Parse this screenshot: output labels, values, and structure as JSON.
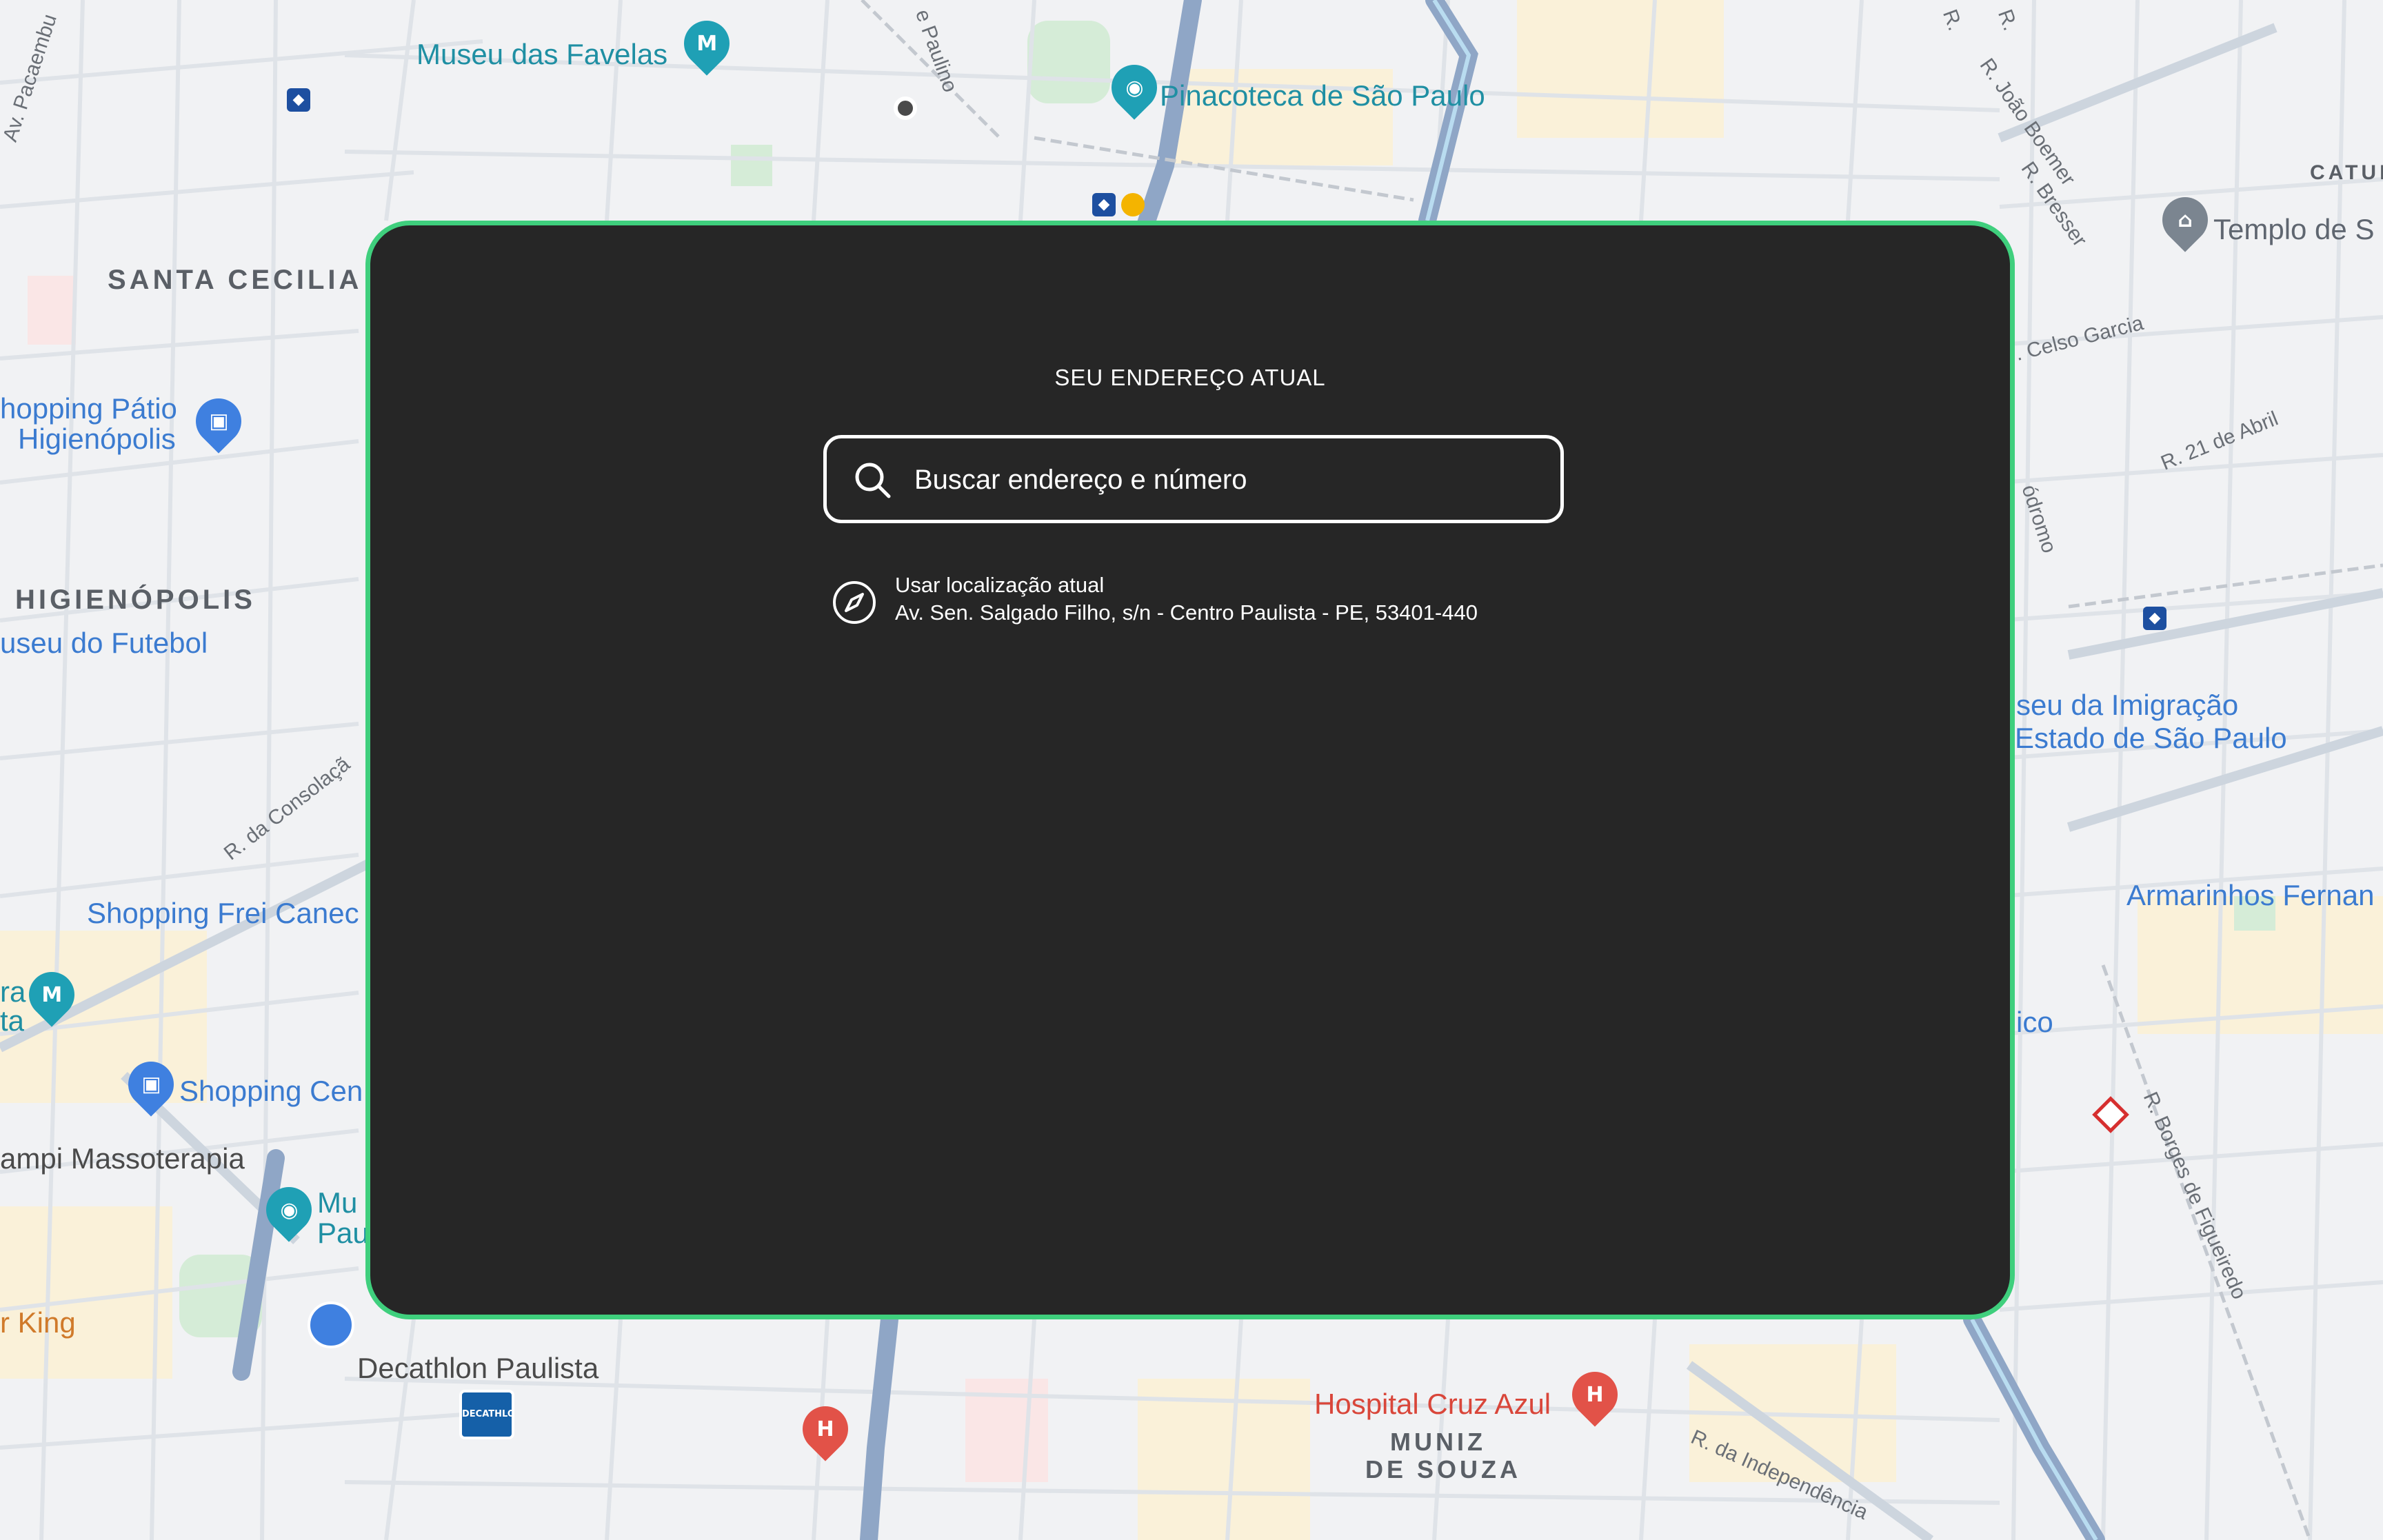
{
  "map": {
    "place_labels": {
      "museu_favelas": "Museu das Favelas",
      "pinacoteca": "Pinacoteca de São Paulo",
      "templo": "Templo de S",
      "catun": "CATUN",
      "santa_cecilia": "SANTA CECILIA",
      "shopping_patio_1": "hopping Pátio",
      "shopping_patio_2": "Higienópolis",
      "higienopolis": "HIGIENÓPOLIS",
      "museu_futebol": "useu do Futebol",
      "museu_imigracao_1": "seu da Imigração",
      "museu_imigracao_2": "Estado de São Paulo",
      "armarinhos": "Armarinhos Fernan",
      "shopping_frei_caneca": "Shopping Frei Canec",
      "ico": "ico",
      "ra": "ra",
      "ta": "ta",
      "shopping_cen": "Shopping Cen",
      "massoterapia": "ampi Massoterapia",
      "mu": "Mu",
      "pau": "Pau",
      "burger_king": "r King",
      "decathlon": "Decathlon Paulista",
      "hospital_cruz_azul": "Hospital Cruz Azul",
      "muniz_1": "MUNIZ",
      "muniz_2": "DE SOUZA"
    },
    "street_labels": {
      "pacaembu": "Av. Pacaembu",
      "paulino": "e Paulino",
      "joao_boemer": "R. João Boemer",
      "bresser": "R. Bresser",
      "celso_garcia": ". Celso Garcia",
      "21_abril": "R. 21 de Abril",
      "odromo": "ódromo",
      "consolacao": "R. da Consolaçã",
      "borges": "R. Borges de Figueiredo",
      "independencia": "R. da Independência",
      "r_a": "R.",
      "r_b": "R."
    },
    "icons": {
      "decathlon_logo_text": "DECATHLON"
    }
  },
  "panel": {
    "title": "SEU ENDEREÇO ATUAL",
    "search": {
      "placeholder": "Buscar endereço e número",
      "value": ""
    },
    "current_location": {
      "title": "Usar localização atual",
      "address": "Av. Sen. Salgado Filho, s/n - Centro Paulista - PE, 53401-440"
    },
    "border_color": "#3fcf7d",
    "background_color": "#262626"
  }
}
